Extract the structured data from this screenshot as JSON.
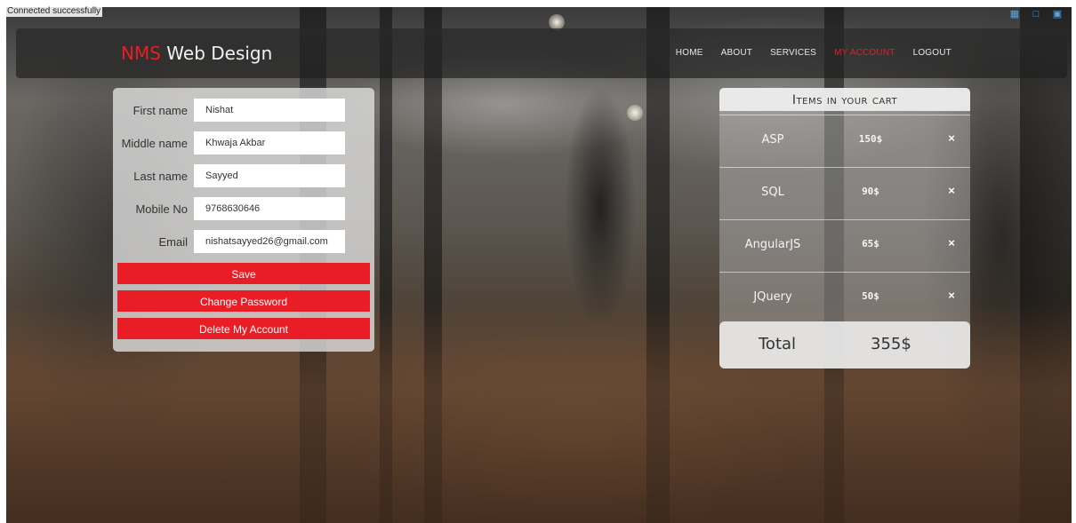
{
  "status": {
    "message": "Connected successfully"
  },
  "brand": {
    "accent": "NMS",
    "rest": " Web Design"
  },
  "nav": {
    "items": [
      "HOME",
      "ABOUT",
      "SERVICES",
      "MY ACCOUNT",
      "LOGOUT"
    ],
    "active": "MY ACCOUNT"
  },
  "profile": {
    "first_name": {
      "label": "First name",
      "value": "Nishat"
    },
    "middle_name": {
      "label": "Middle name",
      "value": "Khwaja Akbar"
    },
    "last_name": {
      "label": "Last name",
      "value": "Sayyed"
    },
    "mobile": {
      "label": "Mobile No",
      "value": "9768630646"
    },
    "email": {
      "label": "Email",
      "value": "nishatsayyed26@gmail.com"
    },
    "save_label": "Save",
    "change_password_label": "Change Password",
    "delete_account_label": "Delete My Account"
  },
  "cart": {
    "title": "Items in your cart",
    "items": [
      {
        "name": "ASP",
        "price": "150$"
      },
      {
        "name": "SQL",
        "price": "90$"
      },
      {
        "name": "AngularJS",
        "price": "65$"
      },
      {
        "name": "JQuery",
        "price": "50$"
      }
    ],
    "remove_glyph": "×",
    "total_label": "Total",
    "total_value": "355$"
  },
  "colors": {
    "accent": "#e81d25",
    "panel": "#e1e1e1"
  },
  "icons": {
    "tray": [
      "network-icon",
      "window-icon",
      "display-icon"
    ]
  }
}
